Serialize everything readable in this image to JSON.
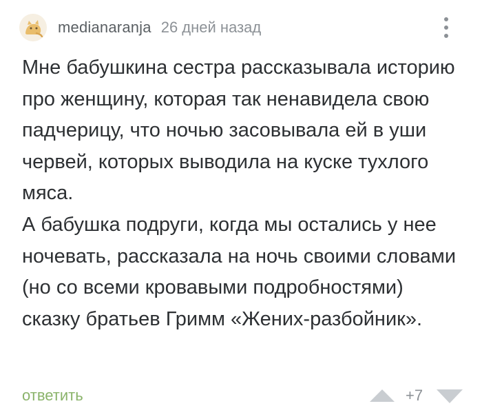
{
  "comment": {
    "author": "medianaranja",
    "time": "26 дней назад",
    "avatar_icon": "cat-avatar-icon",
    "paragraphs": [
      "Мне бабушкина сестра рассказывала историю про женщину, которая так ненавидела свою падчерицу, что ночью засовывала ей в уши червей, которых выводила на куске тухлого мяса.",
      "А бабушка подруги, когда мы остались у нее ночевать, рассказала на ночь своими словами (но со всеми кровавыми подробностями) сказку братьев Гримм «Жених-разбойник»."
    ],
    "reply_label": "ответить",
    "rating": "+7",
    "icons": {
      "menu": "more-vertical-icon",
      "upvote": "upvote-triangle-icon",
      "downvote": "downvote-triangle-icon"
    }
  },
  "colors": {
    "text": "#2d3033",
    "muted": "#8c9196",
    "reply": "#8ab36a",
    "vote": "#c9cdd1"
  }
}
